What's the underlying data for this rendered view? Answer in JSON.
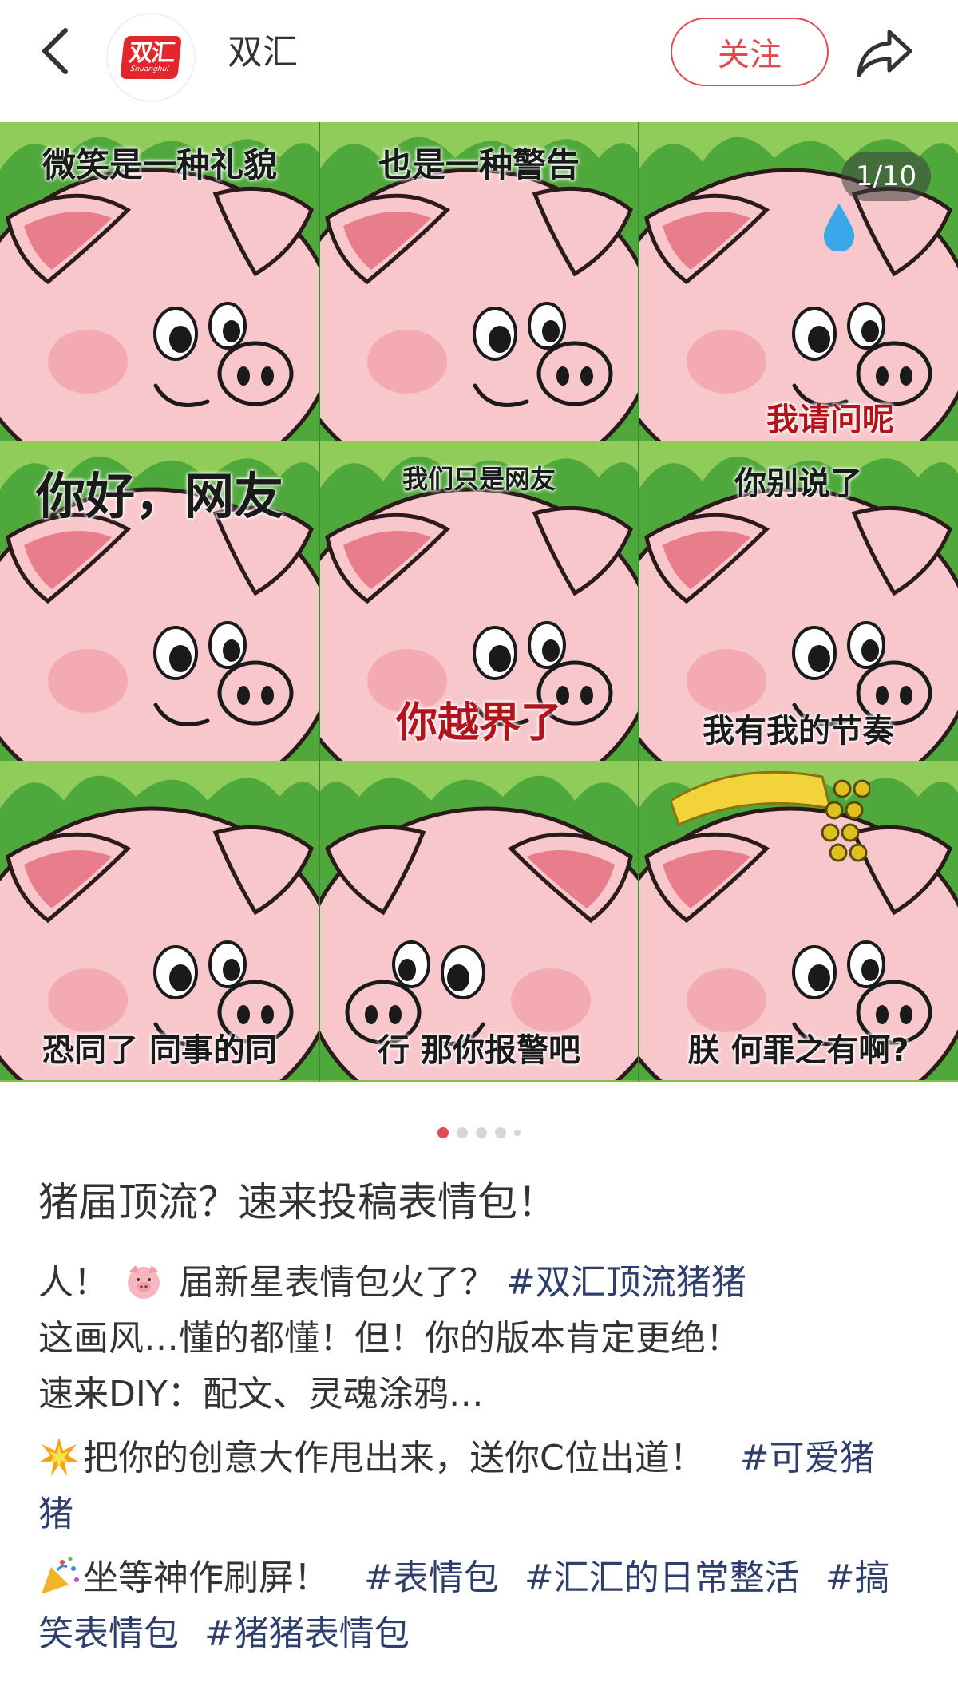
{
  "header": {
    "account_name": "双汇",
    "logo_text": "双汇",
    "logo_sub": "Shuanghui",
    "follow_label": "关注"
  },
  "carousel": {
    "counter": "1/10",
    "captions": {
      "t1": "微笑是一种礼貌",
      "t2": "也是一种警告",
      "t3": "我请问呢",
      "t4": "你好，网友",
      "t5a": "我们只是网友",
      "t5b": "你越界了",
      "t6a": "你别说了",
      "t6b": "我有我的节奏",
      "t7": "恐同了 同事的同",
      "t8": "行 那你报警吧",
      "t9": "朕 何罪之有啊?"
    },
    "dot_count": 5,
    "active_dot": 0
  },
  "post": {
    "title": "猪届顶流？速来投稿表情包！",
    "l1a": "人！",
    "l1b": "届新星表情包火了？",
    "tag1": "#双汇顶流猪猪",
    "l2": "这画风…懂的都懂！但！你的版本肯定更绝！",
    "l3": "速来DIY：配文、灵魂涂鸦…",
    "l4a": "把你的创意大作甩出来，送你C位出道！",
    "tag2a": "#可爱猪",
    "tag2b": "猪",
    "l5a": "坐等神作刷屏！",
    "tag3": "#表情包",
    "tag4": "#汇汇的日常整活",
    "tag5a": "#搞",
    "tag5b": "笑表情包",
    "tag6": "#猪猪表情包"
  },
  "icons": [
    "back-icon",
    "share-icon",
    "pig-emoji-icon",
    "explosion-emoji-icon",
    "party-popper-emoji-icon"
  ],
  "colors": {
    "accent": "#e24a52",
    "tag": "#2e3f6e",
    "grass": "#4fa83c",
    "pig": "#f5c1c7"
  }
}
